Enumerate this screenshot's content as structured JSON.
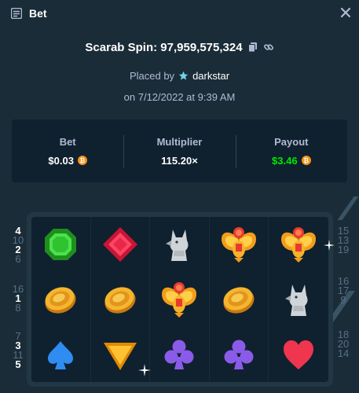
{
  "header": {
    "title": "Bet"
  },
  "bet": {
    "game_name": "Scarab Spin",
    "bet_id": "97,959,575,324",
    "game_line": "Scarab Spin: 97,959,575,324",
    "placed_by_label": "Placed by",
    "username": "darkstar",
    "date_line": "on 7/12/2022 at 9:39 AM"
  },
  "stats": {
    "bet_label": "Bet",
    "bet_value": "$0.03",
    "multiplier_label": "Multiplier",
    "multiplier_value": "115.20×",
    "payout_label": "Payout",
    "payout_value": "$3.46"
  },
  "currency": {
    "symbol": "₿",
    "color": "#f7931a"
  },
  "paylines": {
    "left": [
      [
        "4",
        "10",
        "2",
        "6"
      ],
      [
        "16",
        "1",
        "8"
      ],
      [
        "7",
        "3",
        "11",
        "5"
      ]
    ],
    "left_highlight": [
      "4",
      "2",
      "1",
      "3",
      "5"
    ],
    "right": [
      [
        "15",
        "13",
        "19"
      ],
      [
        "16",
        "17",
        "9"
      ],
      [
        "18",
        "20",
        "14"
      ]
    ]
  },
  "reels": [
    [
      "emerald",
      "ruby",
      "anubis",
      "golden-scarab",
      "golden-scarab"
    ],
    [
      "gold-coin",
      "gold-coin",
      "golden-scarab",
      "gold-coin",
      "anubis"
    ],
    [
      "spade",
      "triangle-gem",
      "club",
      "club",
      "heart"
    ]
  ],
  "colors": {
    "win_green": "#00e701",
    "accent_blue": "#1fff20"
  }
}
